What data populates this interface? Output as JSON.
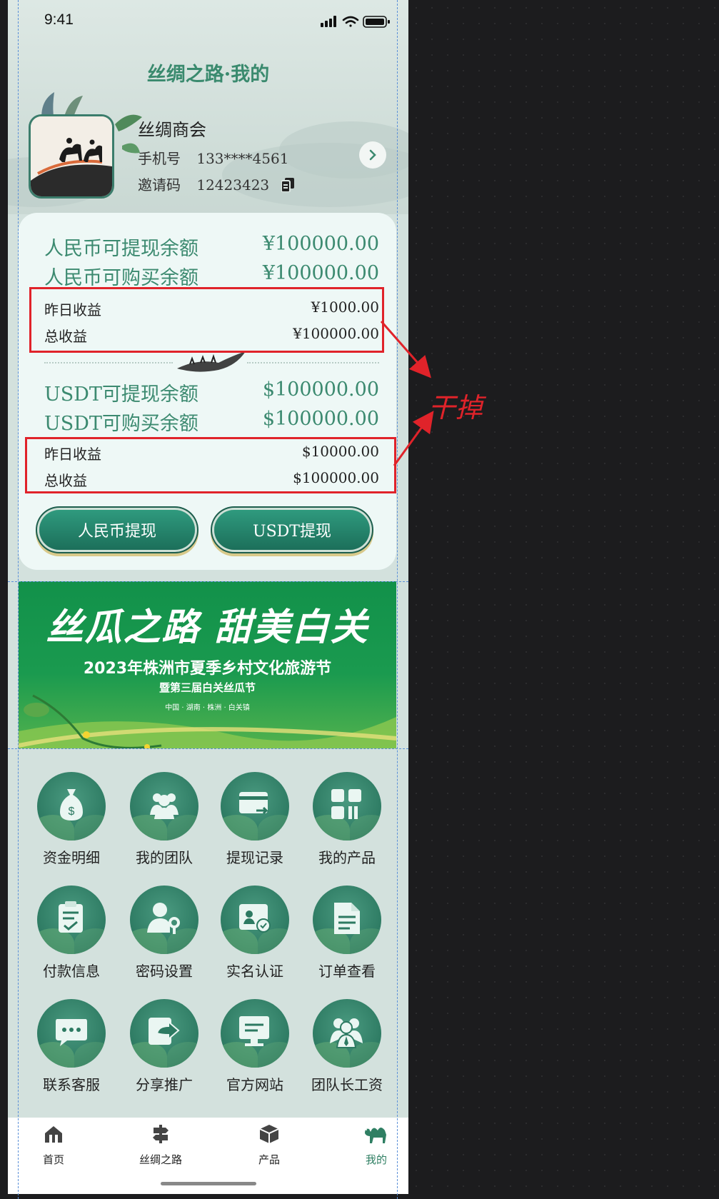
{
  "status_bar": {
    "time": "9:41"
  },
  "header": {
    "title": "丝绸之路·我的"
  },
  "profile": {
    "name": "丝绸商会",
    "phone_label": "手机号",
    "phone_value": "133****4561",
    "invite_label": "邀请码",
    "invite_value": "12423423"
  },
  "balances": {
    "rmb_withdrawable_label": "人民币可提现余额",
    "rmb_withdrawable_value": "¥100000.00",
    "rmb_purchasable_label": "人民币可购买余额",
    "rmb_purchasable_value": "¥100000.00",
    "rmb_yesterday_label": "昨日收益",
    "rmb_yesterday_value": "¥1000.00",
    "rmb_total_label": "总收益",
    "rmb_total_value": "¥100000.00",
    "usdt_withdrawable_label": "USDT可提现余额",
    "usdt_withdrawable_value": "$100000.00",
    "usdt_purchasable_label": "USDT可购买余额",
    "usdt_purchasable_value": "$100000.00",
    "usdt_yesterday_label": "昨日收益",
    "usdt_yesterday_value": "$10000.00",
    "usdt_total_label": "总收益",
    "usdt_total_value": "$100000.00"
  },
  "buttons": {
    "rmb_withdraw": "人民币提现",
    "usdt_withdraw": "USDT提现"
  },
  "banner": {
    "title": "丝瓜之路 甜美白关",
    "line2": "2023年株洲市夏季乡村文化旅游节",
    "line3": "暨第三届白关丝瓜节",
    "line4": "中国 · 湖南 · 株洲 · 白关镇"
  },
  "menu": [
    {
      "label": "资金明细",
      "icon": "money-bag-icon"
    },
    {
      "label": "我的团队",
      "icon": "team-icon"
    },
    {
      "label": "提现记录",
      "icon": "withdraw-card-icon"
    },
    {
      "label": "我的产品",
      "icon": "products-grid-icon"
    },
    {
      "label": "付款信息",
      "icon": "clipboard-check-icon"
    },
    {
      "label": "密码设置",
      "icon": "user-key-icon"
    },
    {
      "label": "实名认证",
      "icon": "id-card-icon"
    },
    {
      "label": "订单查看",
      "icon": "document-icon"
    },
    {
      "label": "联系客服",
      "icon": "chat-bubble-icon"
    },
    {
      "label": "分享推广",
      "icon": "share-icon"
    },
    {
      "label": "官方网站",
      "icon": "monitor-icon"
    },
    {
      "label": "团队长工资",
      "icon": "leader-icon"
    }
  ],
  "tabbar": [
    {
      "label": "首页",
      "icon": "home-icon"
    },
    {
      "label": "丝绸之路",
      "icon": "signpost-icon"
    },
    {
      "label": "产品",
      "icon": "box-icon"
    },
    {
      "label": "我的",
      "icon": "camel-icon",
      "active": true
    }
  ],
  "annotation": {
    "text": "干掉"
  },
  "colors": {
    "accent": "#3c8a70",
    "annotation_red": "#e0232a",
    "tab_active": "#2f7f63"
  }
}
